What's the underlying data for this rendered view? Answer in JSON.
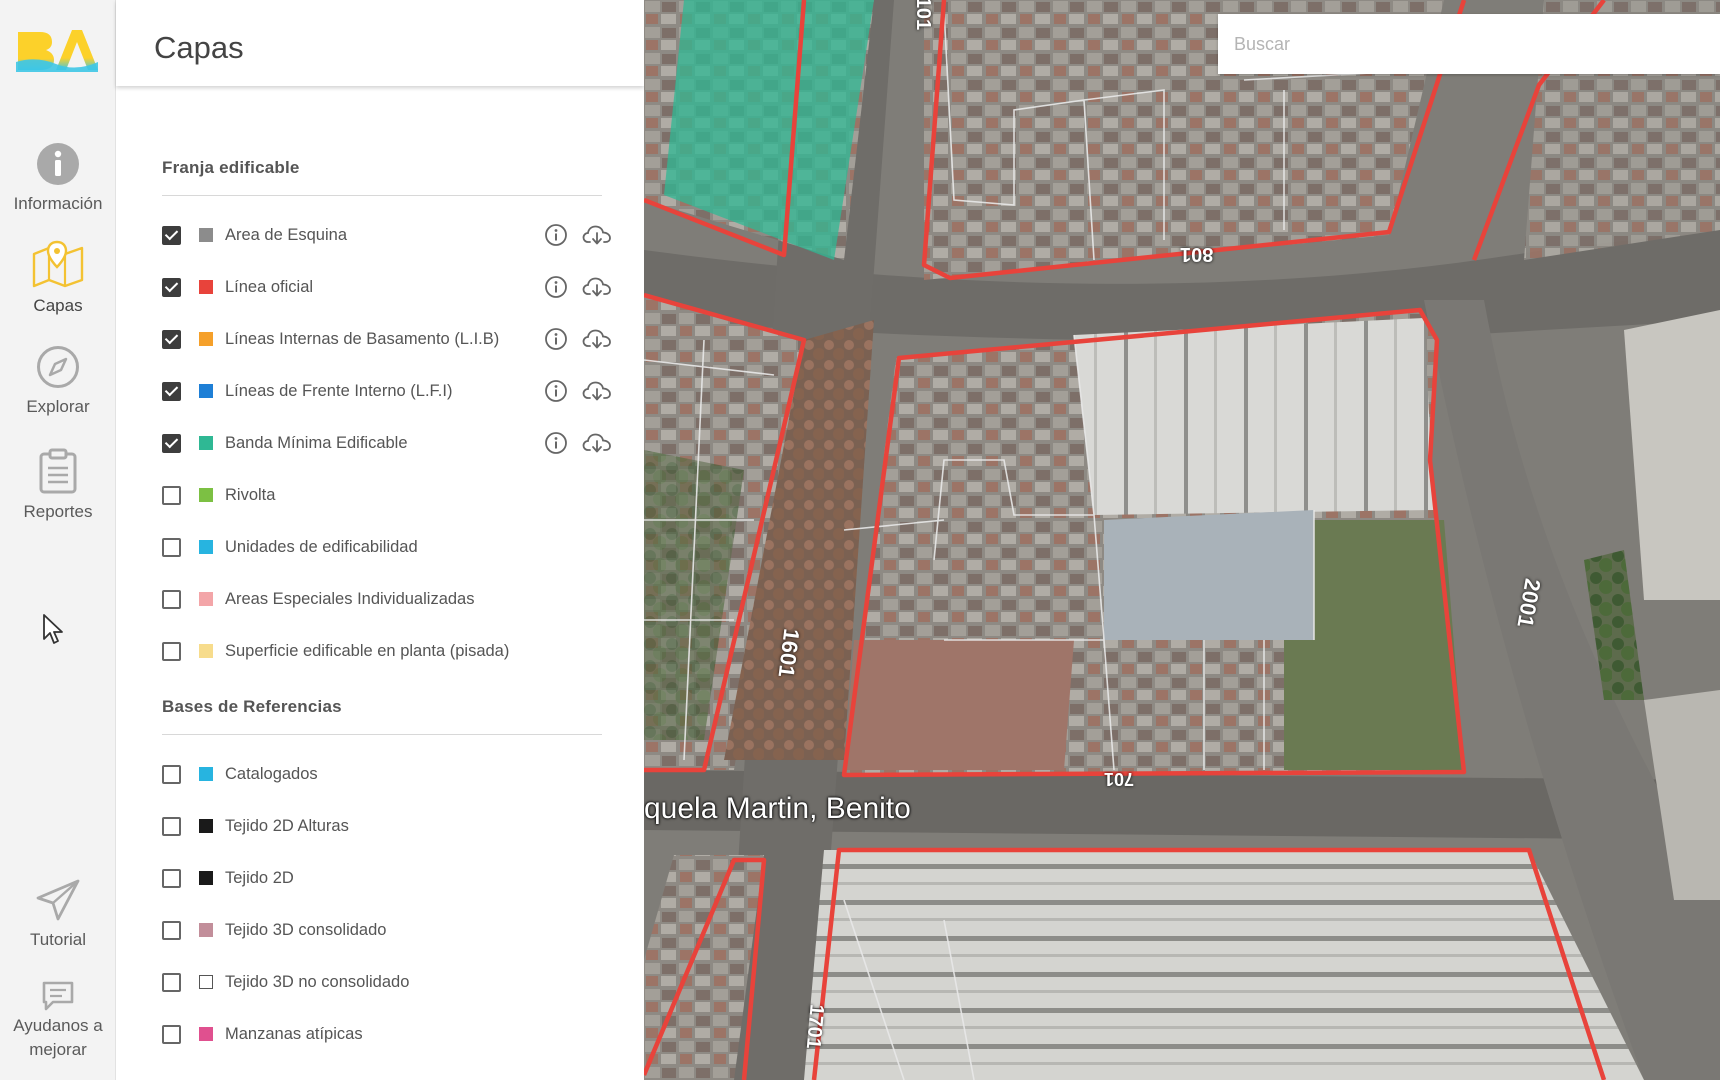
{
  "nav": {
    "logo_text": "BA",
    "items": [
      {
        "label": "Información",
        "icon": "info-icon"
      },
      {
        "label": "Capas",
        "icon": "map-layers-icon"
      },
      {
        "label": "Explorar",
        "icon": "compass-icon"
      },
      {
        "label": "Reportes",
        "icon": "clipboard-icon"
      },
      {
        "label": "Tutorial",
        "icon": "paper-plane-icon"
      },
      {
        "label": "Ayudanos a mejorar",
        "icon": "feedback-icon"
      }
    ]
  },
  "panel": {
    "title": "Capas",
    "sections": [
      {
        "title": "Franja edificable",
        "layers": [
          {
            "name": "Area de Esquina",
            "checked": true,
            "color": "#8c8c8c",
            "actions": true
          },
          {
            "name": "Línea oficial",
            "checked": true,
            "color": "#e8433b",
            "actions": true
          },
          {
            "name": "Líneas Internas de Basamento (L.I.B)",
            "checked": true,
            "color": "#f5a02a",
            "actions": true
          },
          {
            "name": "Líneas de Frente Interno (L.F.I)",
            "checked": true,
            "color": "#1e7fd6",
            "actions": true
          },
          {
            "name": "Banda Mínima Edificable",
            "checked": true,
            "color": "#2fb894",
            "actions": true
          },
          {
            "name": "Rivolta",
            "checked": false,
            "color": "#7cc043",
            "actions": false
          },
          {
            "name": "Unidades de edificabilidad",
            "checked": false,
            "color": "#27b4e0",
            "actions": false
          },
          {
            "name": "Areas Especiales Individualizadas",
            "checked": false,
            "color": "#f3a5a8",
            "actions": false
          },
          {
            "name": "Superficie edificable en planta (pisada)",
            "checked": false,
            "color": "#f7dc8c",
            "actions": false
          }
        ]
      },
      {
        "title": "Bases de Referencias",
        "layers": [
          {
            "name": "Catalogados",
            "checked": false,
            "color": "#27b4e0",
            "actions": false
          },
          {
            "name": "Tejido 2D Alturas",
            "checked": false,
            "color": "#1a1a1a",
            "actions": false
          },
          {
            "name": "Tejido 2D",
            "checked": false,
            "color": "#1a1a1a",
            "actions": false
          },
          {
            "name": "Tejido 3D consolidado",
            "checked": false,
            "color": "#c28e9a",
            "actions": false
          },
          {
            "name": "Tejido 3D no consolidado",
            "checked": false,
            "color": "#ffffff",
            "outline": true,
            "actions": false
          },
          {
            "name": "Manzanas atípicas",
            "checked": false,
            "color": "#e0508f",
            "actions": false
          }
        ]
      }
    ]
  },
  "map": {
    "search_placeholder": "Buscar",
    "street_names": [
      "quela Martin, Benito"
    ],
    "block_numbers": [
      "101",
      "801",
      "1601",
      "2001",
      "1701",
      "701"
    ]
  }
}
